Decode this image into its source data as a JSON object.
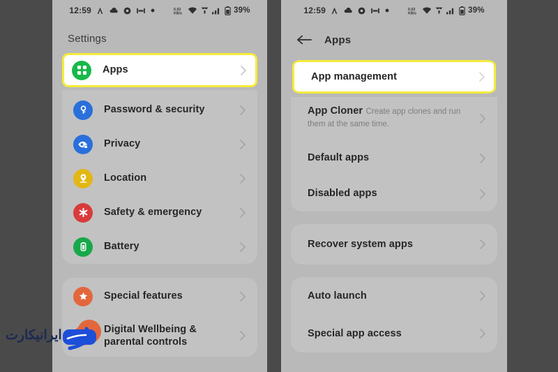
{
  "status_bar": {
    "time": "12:59",
    "battery": "39%",
    "left_icons": [
      "vpn-icon",
      "cloud-icon",
      "record-icon",
      "dnd-icon",
      "dot-icon"
    ],
    "right_icons": [
      "data-speed-icon",
      "wifi-icon",
      "call-icon",
      "signal-icon",
      "battery-icon"
    ]
  },
  "left_screen": {
    "title": "Settings",
    "groups": [
      {
        "items": [
          {
            "label": "Apps",
            "icon": "apps-grid-icon",
            "color": "#18b84a",
            "highlighted": true
          },
          {
            "label": "Password & security",
            "icon": "key-icon",
            "color": "#2a6fdb",
            "highlighted": false
          },
          {
            "label": "Privacy",
            "icon": "eye-lock-icon",
            "color": "#2a6fdb",
            "highlighted": false
          },
          {
            "label": "Location",
            "icon": "location-pin-icon",
            "color": "#e2b714",
            "highlighted": false
          },
          {
            "label": "Safety & emergency",
            "icon": "emergency-star-icon",
            "color": "#d93b3b",
            "highlighted": false
          },
          {
            "label": "Battery",
            "icon": "battery-icon",
            "color": "#18a84a",
            "highlighted": false
          }
        ]
      },
      {
        "items": [
          {
            "label": "Special features",
            "icon": "star-icon",
            "color": "#e2673c",
            "highlighted": false
          },
          {
            "label": "Digital Wellbeing & parental controls",
            "icon": "wellbeing-icon",
            "color": "#e2673c",
            "highlighted": false
          }
        ]
      }
    ]
  },
  "right_screen": {
    "back_icon": "arrow-left-icon",
    "title": "Apps",
    "groups": [
      {
        "items": [
          {
            "label": "App management",
            "sub": "",
            "highlighted": true
          },
          {
            "label": "App Cloner",
            "sub": "Create app clones and run them at the same time.",
            "highlighted": false
          },
          {
            "label": "Default apps",
            "sub": "",
            "highlighted": false
          },
          {
            "label": "Disabled apps",
            "sub": "",
            "highlighted": false
          }
        ]
      },
      {
        "items": [
          {
            "label": "Recover system apps",
            "sub": "",
            "highlighted": false
          }
        ]
      },
      {
        "items": [
          {
            "label": "Auto launch",
            "sub": "",
            "highlighted": false
          },
          {
            "label": "Special app access",
            "sub": "",
            "highlighted": false
          }
        ]
      }
    ]
  },
  "watermark": {
    "text": "ایرانیکارت",
    "logo_color": "#1d4ed8",
    "accent_color": "#e2673c"
  },
  "colors": {
    "page_background": "#b9b9b9",
    "card_background": "#c2c2c2",
    "gutter": "#4a4a4a",
    "highlight_border": "#f5eb3b",
    "highlight_fill": "#ffffff",
    "text_primary": "#262626",
    "text_secondary": "#7e7e7e"
  }
}
